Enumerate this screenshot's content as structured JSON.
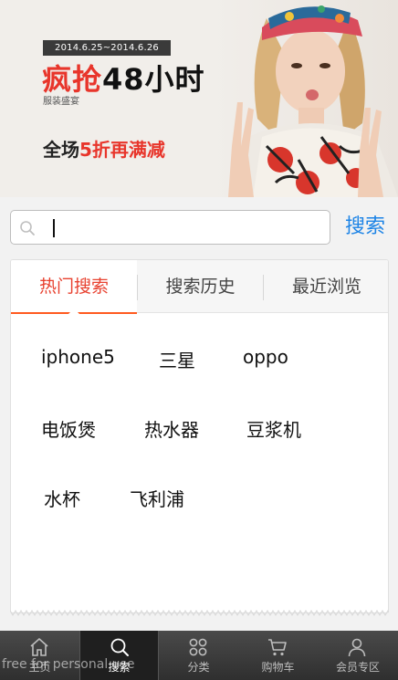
{
  "banner": {
    "date_range": "2014.6.25~2014.6.26",
    "headline_red": "疯抢",
    "headline_black": "48小时",
    "subtitle": "服装盛宴",
    "promo_prefix": "全场",
    "promo_red": "5折再满减"
  },
  "search": {
    "placeholder": "",
    "value": "",
    "button_label": "搜索"
  },
  "tabs": [
    {
      "label": "热门搜索",
      "active": true
    },
    {
      "label": "搜索历史",
      "active": false
    },
    {
      "label": "最近浏览",
      "active": false
    }
  ],
  "hot_terms": [
    [
      "iphone5",
      "三星",
      "oppo"
    ],
    [
      "电饭煲",
      "热水器",
      "豆浆机"
    ],
    [
      "水杯",
      "飞利浦"
    ]
  ],
  "bottom_nav": [
    {
      "label": "主页",
      "icon": "home-icon",
      "active": false
    },
    {
      "label": "搜索",
      "icon": "search-icon",
      "active": true
    },
    {
      "label": "分类",
      "icon": "category-icon",
      "active": false
    },
    {
      "label": "购物车",
      "icon": "cart-icon",
      "active": false
    },
    {
      "label": "会员专区",
      "icon": "member-icon",
      "active": false
    }
  ],
  "watermark": "free for personal use",
  "colors": {
    "accent_blue": "#1d84e6",
    "active_tab_red": "#e8412f",
    "tab_underline": "#ff5a1f",
    "banner_red": "#e8352b"
  }
}
